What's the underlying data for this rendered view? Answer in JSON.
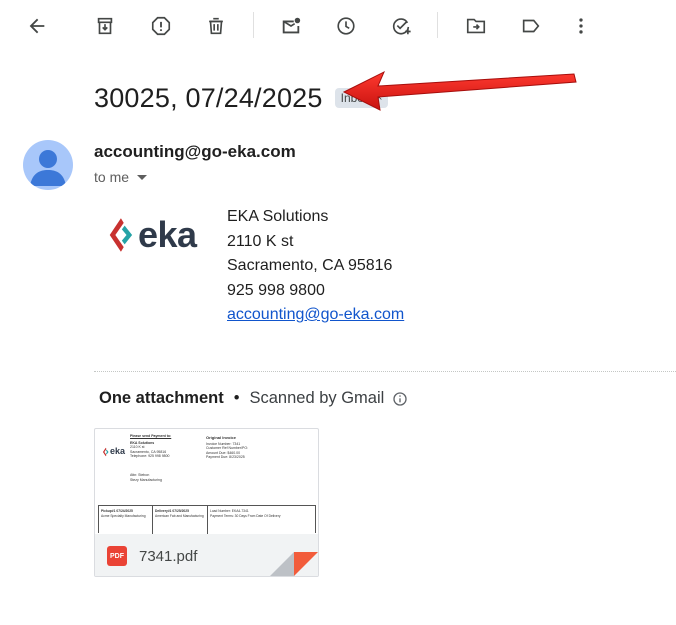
{
  "toolbar": {
    "buttons": [
      "back-icon",
      "archive-icon",
      "report-spam-icon",
      "delete-icon",
      "mark-unread-icon",
      "snooze-icon",
      "add-task-icon",
      "move-to-icon",
      "labels-icon",
      "more-vert-icon"
    ]
  },
  "message": {
    "subject": "30025, 07/24/2025",
    "label": "Inbox",
    "label_close": "×",
    "sender_email": "accounting@go-eka.com",
    "recipient": "to me"
  },
  "signature": {
    "logo_text": "eka",
    "lines": {
      "company": "EKA Solutions",
      "street": "2110 K st",
      "city": "Sacramento, CA 95816",
      "phone": "925 998 9800",
      "email": "accounting@go-eka.com"
    }
  },
  "attachments": {
    "title": "One attachment",
    "separator": "•",
    "scan_status": "Scanned by Gmail",
    "file": {
      "name": "7341.pdf",
      "type_badge": "PDF",
      "preview": {
        "logo": "eka",
        "pay_to": "Please send Payment to:",
        "company": "EKA Solutions",
        "addr1": "2110 K st",
        "addr2": "Sacramento, CA 95816",
        "phone": "Telephone: 925 998 9800",
        "doc_title": "Original Invoice",
        "invoice_no": "Invoice Number: 7341",
        "customer_ref": "Customer Ref Number/PO:",
        "amount_due": "Amount Due: $460.00",
        "payment_due": "Payment Due: 8/23/2025",
        "bill_to1": "Attn: Stebon",
        "bill_to2": "Stezy Manufacturing",
        "pickup": "Pickup#1 07/24/2025",
        "delivery": "Delivery#1 07/25/2025",
        "shipper": "Acme Specialty Manufacturing",
        "consignee": "American Fab and Manufacturing",
        "load_no": "Load Number: EKA4-7341",
        "terms": "Payment Terms: 30 Days From Date Of Delivery"
      }
    }
  },
  "colors": {
    "accent_link": "#1155cc",
    "arrow": "#e8211d",
    "avatar_bg": "#a8c7fa",
    "avatar_fg": "#3c78d8",
    "pdf_badge": "#ea4335",
    "logo_red": "#c8312f",
    "logo_teal": "#25a3a6"
  }
}
